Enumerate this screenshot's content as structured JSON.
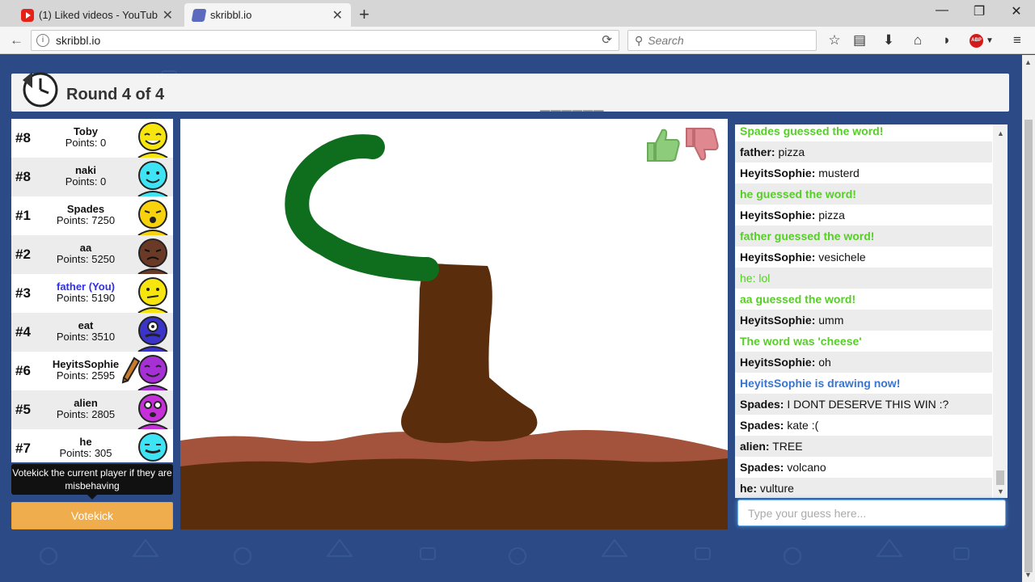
{
  "browser": {
    "tabs": [
      {
        "title": "(1) Liked videos - YouTube",
        "icon": "youtube-icon"
      },
      {
        "title": "skribbl.io",
        "icon": "skribbl-icon"
      }
    ],
    "url": "skribbl.io",
    "search_placeholder": "Search"
  },
  "game": {
    "round_text": "Round 4 of 4",
    "word_hint": "______"
  },
  "players": [
    {
      "rank": "#8",
      "name": "Toby",
      "points": "Points: 0",
      "color": "#f7e60d",
      "you": false
    },
    {
      "rank": "#8",
      "name": "naki",
      "points": "Points: 0",
      "color": "#3fe4f4",
      "you": false
    },
    {
      "rank": "#1",
      "name": "Spades",
      "points": "Points: 7250",
      "color": "#f7d20d",
      "you": false
    },
    {
      "rank": "#2",
      "name": "aa",
      "points": "Points: 5250",
      "color": "#6b3a26",
      "you": false
    },
    {
      "rank": "#3",
      "name": "father (You)",
      "points": "Points: 5190",
      "color": "#f7e60d",
      "you": true
    },
    {
      "rank": "#4",
      "name": "eat",
      "points": "Points: 3510",
      "color": "#3a34c8",
      "you": false
    },
    {
      "rank": "#6",
      "name": "HeyitsSophie",
      "points": "Points: 2595",
      "color": "#a62fd6",
      "you": false,
      "drawing": true
    },
    {
      "rank": "#5",
      "name": "alien",
      "points": "Points: 2805",
      "color": "#c530d8",
      "you": false
    },
    {
      "rank": "#7",
      "name": "he",
      "points": "Points: 305",
      "color": "#3fe4f4",
      "you": false
    }
  ],
  "votekick": {
    "tooltip": "Votekick the current player if they are misbehaving",
    "label": "Votekick"
  },
  "chat": [
    {
      "type": "green",
      "text": "Spades guessed the word!"
    },
    {
      "type": "msg",
      "name": "father:",
      "text": "pizza"
    },
    {
      "type": "msg",
      "name": "HeyitsSophie:",
      "text": "musterd"
    },
    {
      "type": "green",
      "text": "he guessed the word!"
    },
    {
      "type": "msg",
      "name": "HeyitsSophie:",
      "text": "pizza"
    },
    {
      "type": "green",
      "text": "father guessed the word!"
    },
    {
      "type": "msg",
      "name": "HeyitsSophie:",
      "text": "vesichele"
    },
    {
      "type": "green-text",
      "name": "he:",
      "text": "lol"
    },
    {
      "type": "green",
      "text": "aa guessed the word!"
    },
    {
      "type": "msg",
      "name": "HeyitsSophie:",
      "text": "umm"
    },
    {
      "type": "green",
      "text": "The word was 'cheese'"
    },
    {
      "type": "msg",
      "name": "HeyitsSophie:",
      "text": "oh"
    },
    {
      "type": "blue",
      "text": "HeyitsSophie is drawing now!"
    },
    {
      "type": "msg",
      "name": "Spades:",
      "text": "I DONT DESERVE THIS WIN :?"
    },
    {
      "type": "msg",
      "name": "Spades:",
      "text": "kate :("
    },
    {
      "type": "msg",
      "name": "alien:",
      "text": "TREE"
    },
    {
      "type": "msg",
      "name": "Spades:",
      "text": "volcano"
    },
    {
      "type": "msg",
      "name": "he:",
      "text": "vulture"
    }
  ],
  "guess_placeholder": "Type your guess here...",
  "colors": {
    "background": "#2b4a86",
    "votekick": "#f0ad4e",
    "correct_guess": "#56ce27",
    "drawing_notice": "#3975ce",
    "you_name": "#2f2ff0"
  }
}
